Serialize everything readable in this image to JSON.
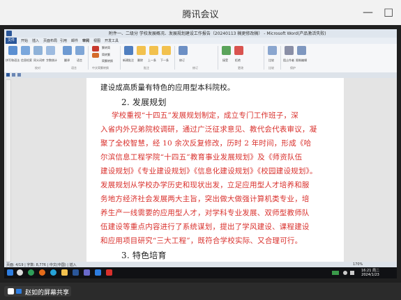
{
  "meeting": {
    "title": "腾讯会议",
    "minimize_glyph": "—",
    "maximize_glyph": "□",
    "sharing_label": "赵如的屏幕共享"
  },
  "word": {
    "doc_title": "附件一、二级分 学校发展概况、发展规划建设工作报告（20240113 稿更修改稿） - Microsoft Word(产品激活失败)",
    "tabs": [
      "文件",
      "开始",
      "插入",
      "页面布局",
      "引用",
      "邮件",
      "审阅",
      "视图",
      "开发工具"
    ],
    "ribbon_groups": [
      "校对",
      "语言",
      "中文简繁转换",
      "批注",
      "修订",
      "更改",
      "比较",
      "保护"
    ],
    "ribbon_labels": [
      "拼写和语法",
      "信息检索",
      "同义词库",
      "字数统计",
      "翻译",
      "语言",
      "繁转简",
      "简转繁",
      "简繁转换",
      "新建批注",
      "删除",
      "上一条",
      "下一条",
      "修订",
      "接受",
      "拒绝",
      "比较",
      "阻止作者",
      "限制编辑"
    ],
    "status_left": "页面: 4/19 | 字数: 8,776 | 中文(中国) | 插入",
    "status_zoom": "170%",
    "ime_label": "中"
  },
  "document": {
    "lines": [
      {
        "text": "建设成高质量有特色的应用型本科院校。",
        "style": "black"
      },
      {
        "text": "2. 发展规划",
        "style": "heading"
      },
      {
        "text": "学校重视“十四五”发展规划制定，成立专门工作班子，深",
        "style": "red"
      },
      {
        "text": "入省内外兄弟院校调研，通过广泛征求意见、教代会代表审议，凝",
        "style": "red"
      },
      {
        "text": "聚了全校智慧，经 10 余次反复修改，历时 2 年时间，形成《哈",
        "style": "red"
      },
      {
        "text": "尔滨信息工程学院“十四五”教育事业发展规划》及《师资队伍",
        "style": "red"
      },
      {
        "text": "建设规划》《专业建设规划》《信息化建设规划》《校园建设规划》。",
        "style": "red"
      },
      {
        "text": "发展规划从学校办学历史和现状出发，立足应用型人才培养和服",
        "style": "red"
      },
      {
        "text": "务地方经济社会发展两大主旨，突出做大做强计算机类专业，培",
        "style": "red"
      },
      {
        "text": "养生产一线需要的应用型人才，对学科专业发展、双师型教师队",
        "style": "red"
      },
      {
        "text": "伍建设等重点内容进行了系统谋划，提出了学风建设、课程建设",
        "style": "red"
      },
      {
        "text": "和应用项目研究“三大工程”，既符合学校实际、又合理可行。",
        "style": "red"
      },
      {
        "text": "3. 特色培育",
        "style": "heading"
      }
    ]
  },
  "taskbar": {
    "time": "16:21 周二",
    "date": "2024/1/23"
  },
  "colors": {
    "red_text": "#d9302c",
    "file_tab": "#2a5699",
    "taskbar": "#101114"
  }
}
